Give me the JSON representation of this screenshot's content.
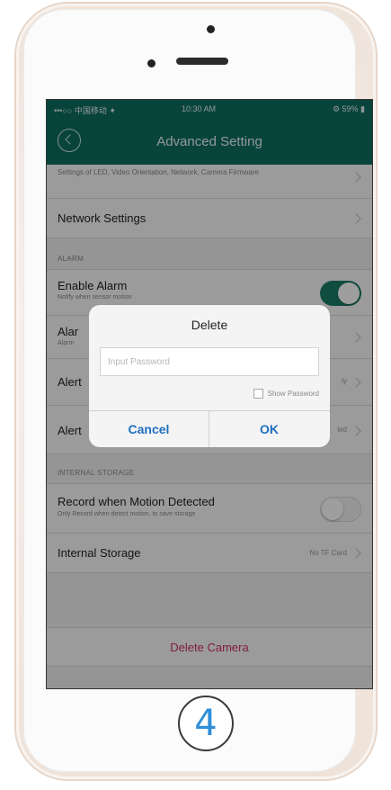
{
  "statusbar": {
    "carrier": "•••○○ 中国移动 ✦",
    "time": "10:30 AM",
    "battery": "⚙ 59% ▮"
  },
  "navbar": {
    "title": "Advanced Setting"
  },
  "rows": {
    "partial_subtitle": "Settings of LED, Video Orientation, Network, Camera Firmware",
    "network_settings": "Network Settings",
    "alarm_header": "ALARM",
    "enable_alarm_title": "Enable Alarm",
    "enable_alarm_sub": "Notify when sensor motion",
    "alarm_row_2_title": "Alar",
    "alarm_row_2_sub": "Alarm",
    "alert_row_1_title": "Alert",
    "alert_row_1_value": "ly",
    "alert_row_2_title": "Alert",
    "alert_row_2_value": "led",
    "internal_storage_header": "INTERNAL STORAGE",
    "record_motion_title": "Record when Motion Detected",
    "record_motion_sub": "Only Record when detect motion, to save storage",
    "internal_storage_title": "Internal Storage",
    "internal_storage_value": "No TF Card",
    "delete_camera": "Delete Camera"
  },
  "toggles": {
    "enable_alarm": true,
    "record_motion": false
  },
  "dialog": {
    "title": "Delete",
    "password_placeholder": "Input Password",
    "password_value": "",
    "show_password_label": "Show Password",
    "show_password_checked": false,
    "cancel_label": "Cancel",
    "ok_label": "OK"
  },
  "device": {
    "home_button_label": "4"
  },
  "colors": {
    "accent": "#0e6e62",
    "toggle_on": "#1a7d67",
    "destructive": "#d0335e",
    "dialog_button": "#1f6fbf",
    "home_number": "#2f8fd8"
  }
}
